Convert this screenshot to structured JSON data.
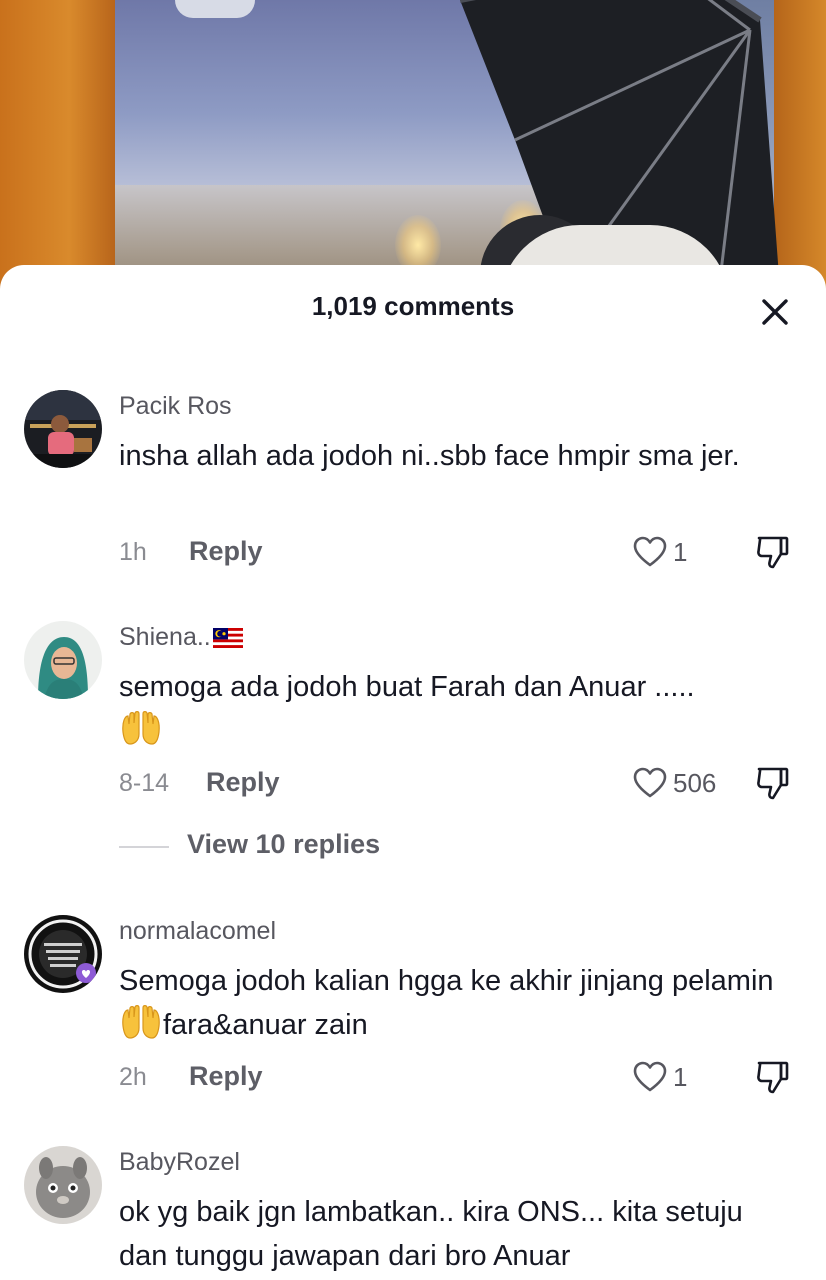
{
  "sheet": {
    "title": "1,019 comments",
    "close_icon": "close-icon"
  },
  "comments": [
    {
      "username": "Pacik Ros",
      "text": "insha allah ada jodoh ni..sbb face hmpir sma jer.",
      "time": "1h",
      "reply_label": "Reply",
      "likes": "1"
    },
    {
      "username": "Shiena..",
      "flag": "malaysia-flag-icon",
      "text": "semoga ada jodoh buat Farah dan Anuar .....",
      "emoji": "raising-hands-emoji",
      "time": "8-14",
      "reply_label": "Reply",
      "likes": "506",
      "view_replies": "View 10 replies"
    },
    {
      "username": "normalacomel",
      "text_before_emoji": "Semoga jodoh kalian hgga ke akhir jinjang pelamin ",
      "text_after_emoji": "fara&anuar zain",
      "emoji": "raising-hands-emoji",
      "time": "2h",
      "reply_label": "Reply",
      "likes": "1"
    },
    {
      "username": "BabyRozel",
      "text": "ok yg baik jgn lambatkan.. kira ONS... kita setuju dan tunggu jawapan dari bro Anuar"
    }
  ],
  "colors": {
    "text_primary": "#161823",
    "text_secondary": "#57575f",
    "text_muted": "#8a8b91"
  }
}
